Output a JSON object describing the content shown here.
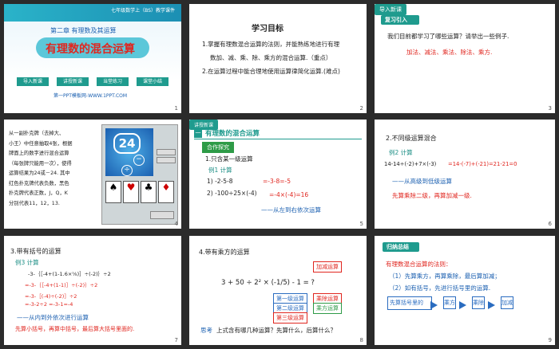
{
  "slide1": {
    "header": "七年级数学上（BS）教学课件",
    "chapter": "第二章 有理数及其运算",
    "title": "有理数的混合运算",
    "steps": [
      "导入新课",
      "讲授新课",
      "当堂练习",
      "课堂小结"
    ],
    "footer": "第一PPT模板网-WWW.1PPT.COM",
    "num": "1"
  },
  "slide2": {
    "title": "学习目标",
    "goals": [
      "1.掌握有理数混合运算的法则，并能熟练地进行有理",
      "数加、减、乘、除、乘方的混合运算.（重点）",
      "2.在运算过程中能合理地使用运算律简化运算.(难点)"
    ],
    "num": "2"
  },
  "slide3": {
    "tag": "导入新课",
    "section": "复习引入",
    "question": "我们目前都学习了哪些运算？请举出一些例子.",
    "answer": "加法、减法、乘法、除法、乘方.",
    "num": "3"
  },
  "slide4": {
    "lines": [
      "从一副扑克牌（去掉大、",
      "小王）中任意抽取4张，根据",
      "牌面上的数字进行混合运算",
      "（每张牌只能用一次），使得",
      "运算结果为24或－24. 其中",
      "红色扑克牌代表负数，黑色",
      "扑克牌代表正数，J，Q，K",
      "分别代表11，12，13."
    ],
    "game_number": "24",
    "num": "4"
  },
  "slide5": {
    "tag": "讲授新课",
    "banner_num": "一",
    "banner": "有理数的混合运算",
    "chip": "合作探究",
    "heading": "1.只含某一级运算",
    "example": "例1  计算",
    "p1_left": "1)  -2-5-8",
    "p1_right": "=-3-8=-5",
    "p2_left": "2)  -100÷25×(-4)",
    "p2_right": "=-4×(-4)=16",
    "note": "——从左到右依次运算",
    "num": "5"
  },
  "slide6": {
    "heading": "2.不同级运算混合",
    "example": "例2  计算",
    "expr": "14-14÷(-2)+7×(-3)",
    "result": "=14-(-7)+(-21)=21-21=0",
    "note1": "——从高级到低级运算",
    "note2": "先算乘除二级，再算加减一级.",
    "num": "6"
  },
  "slide7": {
    "heading": "3.带有括号的运算",
    "example": "例3  计算",
    "line1": "-3-｛［-4+(1-1.6×⅝)］÷(-2)｝÷2",
    "line2": "=-3-｛［-4+(1-1)］÷(-2)｝÷2",
    "line3": "=-3-［(-4)÷(-2)］÷2",
    "line4": "=-3-2÷2 =-3-1=-4",
    "note1": "——从内到外依次进行运算",
    "note2": "先算小括号，再算中括号，最后算大括号里面的.",
    "num": "7"
  },
  "slide8": {
    "heading": "4.带有乘方的运算",
    "expr": "3 + 50 ÷ 2² × (-1/5) - 1 = ?",
    "labels": {
      "first": "第一级运算",
      "second": "第二级运算",
      "third": "第三级运算",
      "add_sub": "加减运算",
      "mul_div": "乘除运算",
      "power": "乘方运算"
    },
    "think_label": "思考",
    "think": "上式含有哪几种运算？先算什么，后算什么？",
    "num": "8"
  },
  "slide9": {
    "tag": "归纳总结",
    "rule_title": "有理数混合运算的法则：",
    "r1": "（1）先算乘方，再算乘除，最后算加减；",
    "r2": "（2）如有括号，先进行括号里的运算.",
    "flow": [
      "先算括号里的",
      "乘方",
      "乘除",
      "加减"
    ],
    "num": "9"
  },
  "colors": {
    "teal": "#1f9b8e",
    "red": "#e0261f",
    "blue": "#1a5fb0",
    "green": "#2e9b47"
  }
}
